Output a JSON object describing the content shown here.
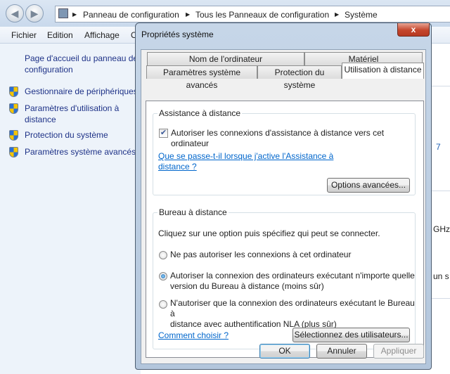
{
  "explorer": {
    "breadcrumb": [
      "Panneau de configuration",
      "Tous les Panneaux de configuration",
      "Système"
    ],
    "menu": [
      "Fichier",
      "Edition",
      "Affichage",
      "O"
    ],
    "sidebar": {
      "home_link": [
        "Page d'accueil du panneau de",
        "configuration"
      ],
      "items": [
        {
          "label": [
            "Gestionnaire de périphériques"
          ],
          "icon": "uac-shield-icon"
        },
        {
          "label": [
            "Paramètres d'utilisation à",
            "distance"
          ],
          "icon": "uac-shield-icon"
        },
        {
          "label": [
            "Protection du système"
          ],
          "icon": "uac-shield-icon"
        },
        {
          "label": [
            "Paramètres système avancés"
          ],
          "icon": "uac-shield-icon"
        }
      ]
    },
    "right_fragments": [
      "7",
      "GHz",
      "un s"
    ]
  },
  "dialog": {
    "title": "Propriétés système",
    "close_label": "x",
    "tabs_row1": [
      "Nom de l'ordinateur",
      "Matériel"
    ],
    "tabs_row2": [
      "Paramètres système avancés",
      "Protection du système",
      "Utilisation à distance"
    ],
    "active_tab": "Utilisation à distance",
    "assistance": {
      "legend": "Assistance à distance",
      "checkbox_label": "Autoriser les connexions d'assistance à distance vers cet ordinateur",
      "checked": true,
      "help_link": [
        "Que se passe-t-il lorsque j'active l'Assistance à",
        "distance ?"
      ],
      "advanced_button": "Options avancées..."
    },
    "bureau": {
      "legend": "Bureau à distance",
      "instruction": "Cliquez sur une option puis spécifiez qui peut se connecter.",
      "options": [
        {
          "label": [
            "Ne pas autoriser les connexions à cet ordinateur"
          ],
          "selected": false
        },
        {
          "label": [
            "Autoriser la connexion des ordinateurs exécutant n'importe quelle",
            "version du Bureau à distance (moins sûr)"
          ],
          "selected": true
        },
        {
          "label": [
            "N'autoriser que la connexion des ordinateurs exécutant le Bureau à",
            "distance avec authentification NLA (plus sûr)"
          ],
          "selected": false
        }
      ],
      "help_link": "Comment choisir ?",
      "select_users_button": "Sélectionnez des utilisateurs..."
    },
    "buttons": {
      "ok": "OK",
      "cancel": "Annuler",
      "apply": "Appliquer"
    },
    "colors": {
      "link": "#0066cc",
      "close": "#c4462c"
    }
  }
}
